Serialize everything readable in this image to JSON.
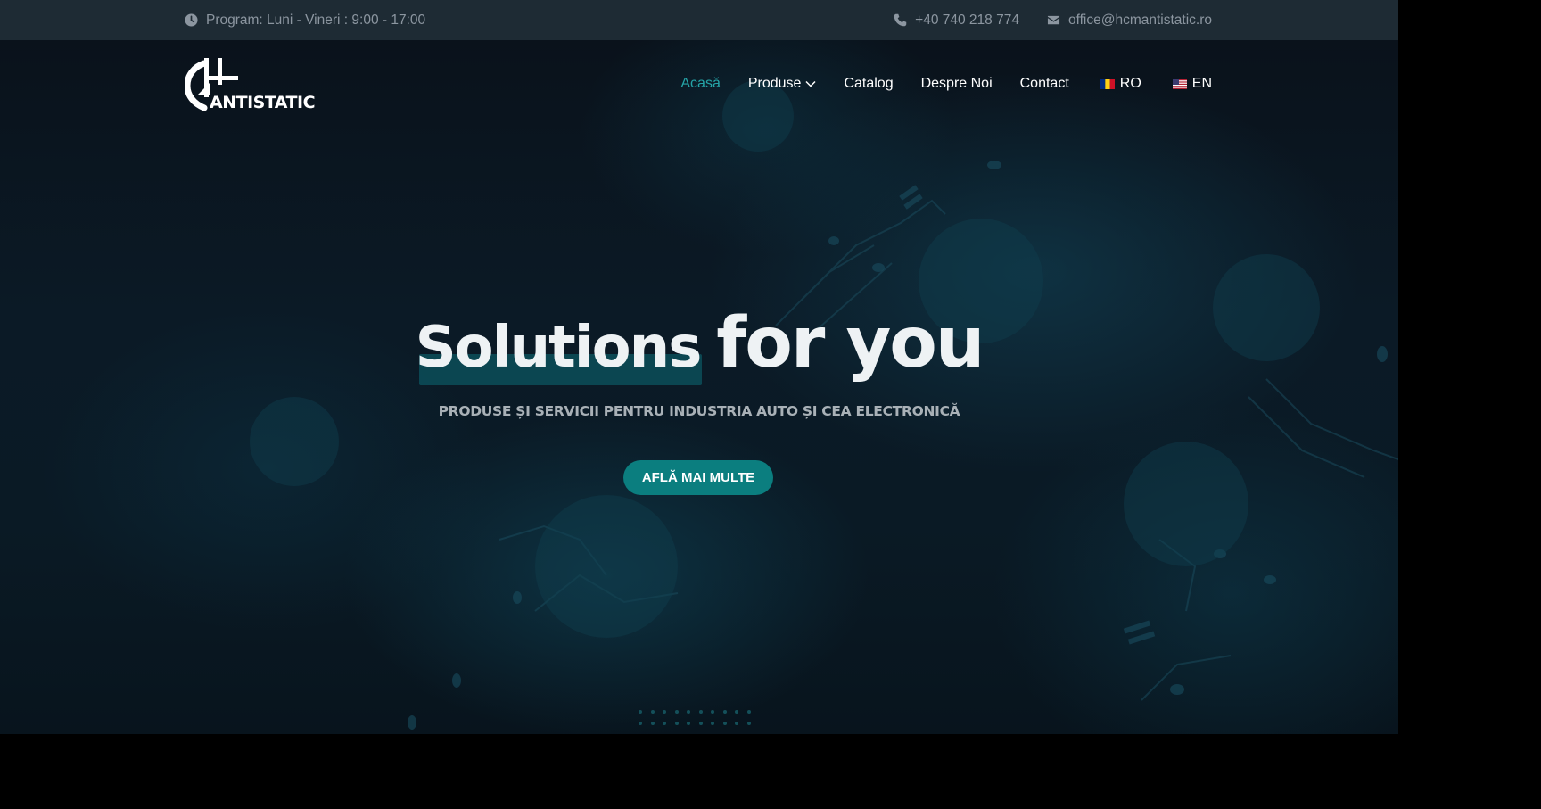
{
  "topbar": {
    "schedule": "Program: Luni - Vineri : 9:00 - 17:00",
    "phone": "+40 740 218 774",
    "email": "office@hcmantistatic.ro",
    "icons": [
      "clock-icon",
      "phone-icon",
      "envelope-icon"
    ]
  },
  "logo": {
    "text": "ANTISTATIC"
  },
  "nav": {
    "items": [
      {
        "label": "Acasă",
        "active": true
      },
      {
        "label": "Produse",
        "has_dropdown": true
      },
      {
        "label": "Catalog"
      },
      {
        "label": "Despre Noi"
      },
      {
        "label": "Contact"
      }
    ],
    "languages": [
      {
        "label": "RO",
        "flag": "romania-flag-icon"
      },
      {
        "label": "EN",
        "flag": "usa-flag-icon"
      }
    ]
  },
  "hero": {
    "headline_highlight": "Solutions",
    "headline_rest": "for you",
    "subtitle": "PRODUSE ȘI SERVICII PENTRU INDUSTRIA AUTO ȘI CEA ELECTRONICĂ",
    "cta_label": "AFLĂ MAI MULTE"
  },
  "colors": {
    "accent": "#25a5a8",
    "button": "#0b7e7f",
    "topbar_bg": "#1e2b34",
    "hero_bg": "#0b1a26",
    "text_muted": "#8c96a0"
  }
}
